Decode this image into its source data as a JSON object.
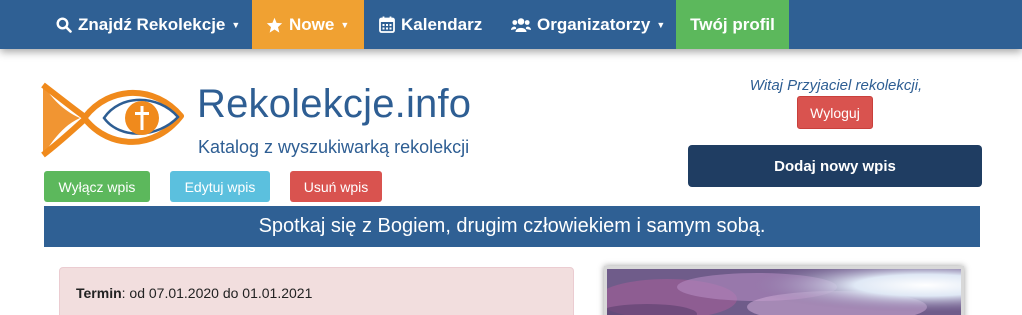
{
  "nav": {
    "items": [
      {
        "label": "Znajdź Rekolekcje",
        "icon": "search-icon",
        "dropdown": true
      },
      {
        "label": "Nowe",
        "icon": "star-icon",
        "dropdown": true
      },
      {
        "label": "Kalendarz",
        "icon": "calendar-icon",
        "dropdown": false
      },
      {
        "label": "Organizatorzy",
        "icon": "users-icon",
        "dropdown": true
      },
      {
        "label": "Twój profil",
        "icon": "",
        "dropdown": false
      }
    ]
  },
  "header": {
    "title": "Rekolekcje.info",
    "subtitle": "Katalog z wyszukiwarką rekolekcji",
    "welcome": "Witaj Przyjaciel rekolekcji,",
    "logout_label": "Wyloguj",
    "add_post_label": "Dodaj nowy wpis"
  },
  "post_actions": {
    "disable_label": "Wyłącz wpis",
    "edit_label": "Edytuj wpis",
    "delete_label": "Usuń wpis"
  },
  "banner": {
    "text": "Spotkaj się z Bogiem, drugim człowiekiem i samym sobą."
  },
  "info": {
    "term_label": "Termin",
    "term_value": ": od 07.01.2020 do 01.01.2021"
  },
  "colors": {
    "navbar": "#2f6094",
    "nav_new": "#f0a132",
    "nav_profile": "#5cb85c",
    "title": "#2e5e93",
    "danger": "#d9534f",
    "info": "#5bc0de",
    "dark_button": "#1f3d62"
  }
}
